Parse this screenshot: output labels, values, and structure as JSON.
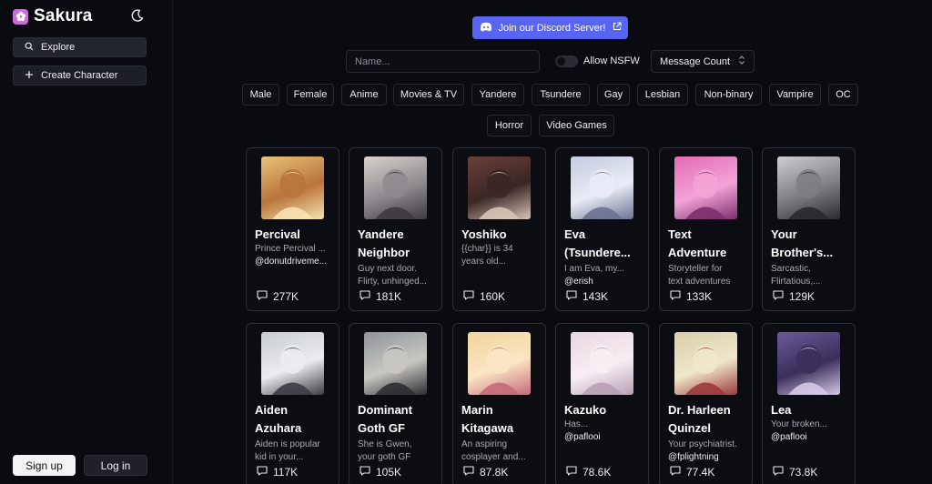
{
  "brand": {
    "name": "Sakura",
    "logo_color": "#c86fd6"
  },
  "sidebar": {
    "explore_label": "Explore",
    "create_label": "Create Character",
    "signup_label": "Sign up",
    "login_label": "Log in"
  },
  "discord": {
    "label": "Join our Discord Server!",
    "color": "#5865f2"
  },
  "filters": {
    "name_placeholder": "Name...",
    "nsfw_label": "Allow NSFW",
    "sort_value": "Message Count"
  },
  "tags": [
    "Male",
    "Female",
    "Anime",
    "Movies & TV",
    "Yandere",
    "Tsundere",
    "Gay",
    "Lesbian",
    "Non-binary",
    "Vampire",
    "OC",
    "Horror",
    "Video Games"
  ],
  "characters": [
    {
      "name1": "Percival",
      "name2": "",
      "desc1": "Prince Percival ...",
      "desc2": "",
      "author": "@donutdriveme...",
      "count": "277K"
    },
    {
      "name1": "Yandere",
      "name2": "Neighbor",
      "desc1": "Guy next door.",
      "desc2": "Flirty, unhinged...",
      "author": "",
      "count": "181K"
    },
    {
      "name1": "Yoshiko",
      "name2": "",
      "desc1": "{{char}} is 34",
      "desc2": "years old...",
      "author": "",
      "count": "160K"
    },
    {
      "name1": "Eva",
      "name2": "(Tsundere...",
      "desc1": "I am Eva, my...",
      "desc2": "",
      "author": "@erish",
      "count": "143K"
    },
    {
      "name1": "Text",
      "name2": "Adventure",
      "desc1": "Storyteller for",
      "desc2": "text adventures",
      "author": "",
      "count": "133K"
    },
    {
      "name1": "Your",
      "name2": "Brother's...",
      "desc1": "Sarcastic,",
      "desc2": "Flirtatious,...",
      "author": "",
      "count": "129K"
    },
    {
      "name1": "Aiden",
      "name2": "Azuhara",
      "desc1": "Aiden is popular",
      "desc2": "kid in your...",
      "author": "",
      "count": "117K"
    },
    {
      "name1": "Dominant",
      "name2": "Goth GF",
      "desc1": "She is Gwen,",
      "desc2": "your goth GF",
      "author": "",
      "count": "105K"
    },
    {
      "name1": "Marin",
      "name2": "Kitagawa",
      "desc1": "An aspiring",
      "desc2": "cosplayer and...",
      "author": "",
      "count": "87.8K"
    },
    {
      "name1": "Kazuko",
      "name2": "",
      "desc1": "Has...",
      "desc2": "",
      "author": "@paflooi",
      "count": "78.6K"
    },
    {
      "name1": "Dr. Harleen",
      "name2": "Quinzel",
      "desc1": "Your psychiatrist.",
      "desc2": "",
      "author": "@fplightning",
      "count": "77.4K"
    },
    {
      "name1": "Lea",
      "name2": "",
      "desc1": "Your broken...",
      "desc2": "",
      "author": "@paflooi",
      "count": "73.8K"
    }
  ]
}
